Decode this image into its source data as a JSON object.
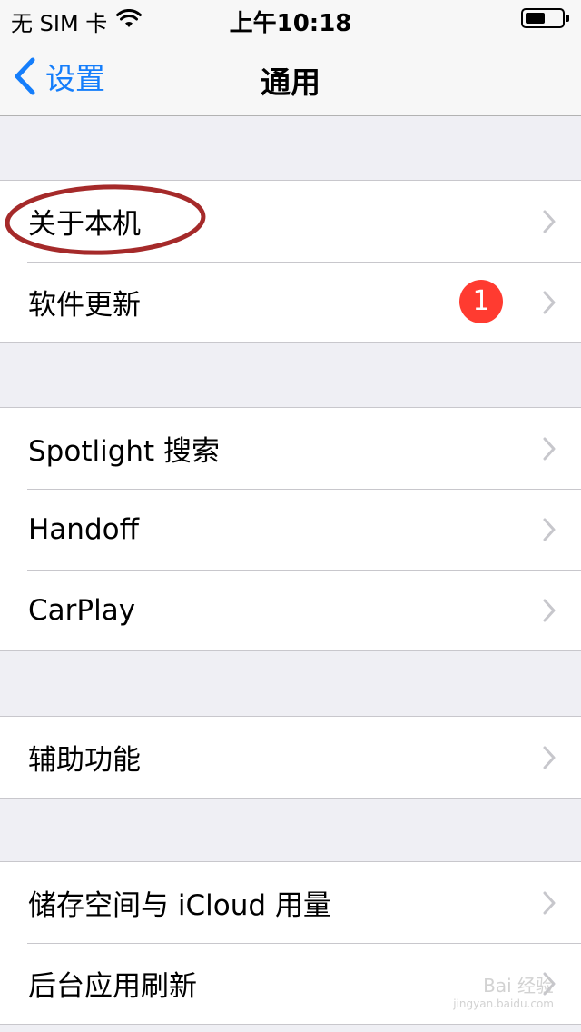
{
  "status_bar": {
    "carrier": "无 SIM 卡",
    "time": "上午10:18",
    "battery_level": 0.55
  },
  "nav": {
    "back_label": "设置",
    "title": "通用"
  },
  "groups": [
    {
      "items": [
        {
          "label": "关于本机"
        },
        {
          "label": "软件更新",
          "badge": "1"
        }
      ]
    },
    {
      "items": [
        {
          "label": "Spotlight 搜索"
        },
        {
          "label": "Handoff"
        },
        {
          "label": "CarPlay"
        }
      ]
    },
    {
      "items": [
        {
          "label": "辅助功能"
        }
      ]
    },
    {
      "items": [
        {
          "label": "储存空间与 iCloud 用量"
        },
        {
          "label": "后台应用刷新"
        }
      ]
    }
  ],
  "watermark": {
    "text": "Bai 经验",
    "sub": "jingyan.baidu.com"
  },
  "colors": {
    "accent": "#157efb",
    "badge": "#ff3b30",
    "background": "#efeff4",
    "annotation": "#a52a2a"
  }
}
